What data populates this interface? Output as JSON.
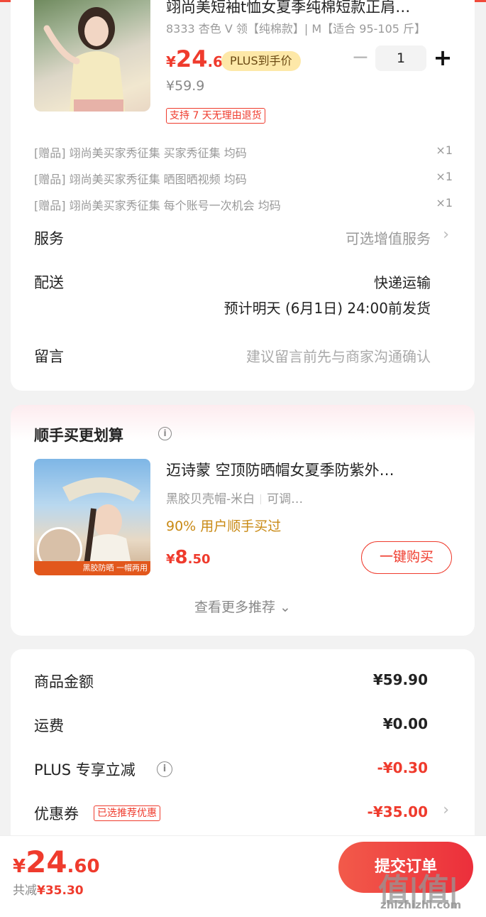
{
  "product": {
    "title": "翊尚美短袖t恤女夏季纯棉短款正肩…",
    "spec": "8333 杏色 V 领【纯棉款】| M【适合 95-105 斤】",
    "price_symbol": "¥",
    "price_int": "24",
    "price_dec": ".6",
    "plus_tag": "PLUS到手价",
    "original_price": "¥59.9",
    "quantity": "1",
    "minus": "−",
    "plus": "+",
    "return_policy": "支持 7 天无理由退货"
  },
  "gifts": [
    {
      "text": "[赠品] 翊尚美买家秀征集 买家秀征集 均码",
      "qty": "×1"
    },
    {
      "text": "[赠品] 翊尚美买家秀征集 晒图晒视频 均码",
      "qty": "×1"
    },
    {
      "text": "[赠品] 翊尚美买家秀征集 每个账号一次机会 均码",
      "qty": "×1"
    }
  ],
  "service": {
    "label": "服务",
    "value": "可选增值服务"
  },
  "delivery": {
    "label": "配送",
    "method": "快递运输",
    "eta": "预计明天 (6月1日) 24:00前发货"
  },
  "message": {
    "label": "留言",
    "placeholder": "建议留言前先与商家沟通确认"
  },
  "recommend": {
    "title": "顺手买更划算",
    "name": "迈诗蒙 空顶防晒帽女夏季防紫外…",
    "spec1": "黑胶贝壳帽-米白",
    "spec2": "可调…",
    "bought": "90% 用户顺手买过",
    "price_symbol": "¥",
    "price_int": "8",
    "price_dec": ".50",
    "buy_label": "一键购买",
    "img_banner": "黑胶防晒 一帽两用",
    "more": "查看更多推荐 ⌄"
  },
  "summary": {
    "goods_label": "商品金额",
    "goods_value": "¥59.90",
    "shipping_label": "运费",
    "shipping_value": "¥0.00",
    "plus_label": "PLUS 专享立减",
    "plus_value": "-¥0.30",
    "coupon_label": "优惠券",
    "coupon_tag": "已选推荐优惠",
    "coupon_value": "-¥35.00"
  },
  "footer": {
    "total_symbol": "¥",
    "total_int": "24",
    "total_dec": ".60",
    "saved_label": "共减",
    "saved_amount": "¥35.30",
    "submit_label": "提交订单",
    "watermark": "值|值|值",
    "watermark_url": "zhizhizhi.com"
  },
  "colors": {
    "accent": "#ef3b2d",
    "plus_tag_bg": "#fde8a8",
    "gold_text": "#c98a15"
  }
}
